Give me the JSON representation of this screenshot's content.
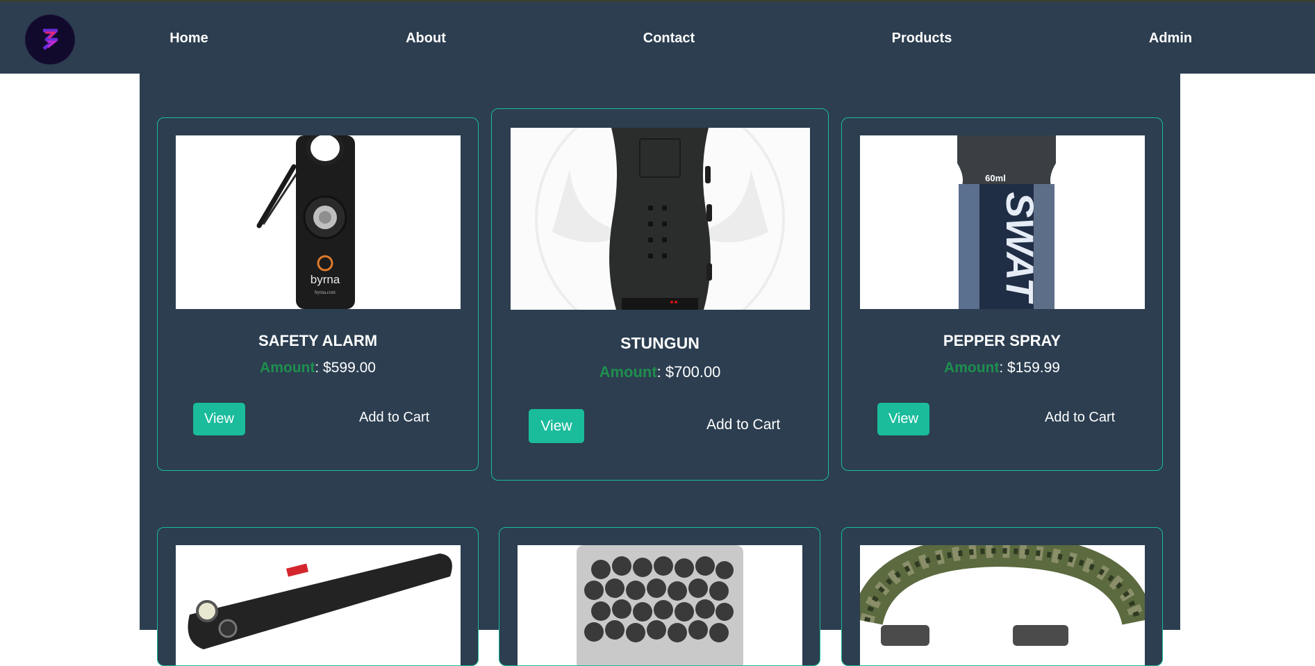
{
  "nav": {
    "logo_alt": "logo",
    "links": [
      "Home",
      "About",
      "Contact",
      "Products",
      "Admin"
    ]
  },
  "colors": {
    "navbar": "#2c3e50",
    "accent": "#1abc9c",
    "amount_label": "#1e8f4e"
  },
  "products": [
    {
      "name": "SAFETY ALARM",
      "amount_label": "Amount",
      "price": ": $599.00",
      "view_label": "View",
      "cart_label": "Add to Cart",
      "image": "black keychain safety alarm with carabiner, byrna brand"
    },
    {
      "name": "STUNGUN",
      "amount_label": "Amount",
      "price": ": $700.00",
      "view_label": "View",
      "cart_label": "Add to Cart",
      "image": "black handheld stun gun"
    },
    {
      "name": "PEPPER SPRAY",
      "amount_label": "Amount",
      "price": ": $159.99",
      "view_label": "View",
      "cart_label": "Add to Cart",
      "image": "SWAT pepper spray canister 60ml"
    },
    {
      "name": "",
      "image": "black pepper ball launcher pistol"
    },
    {
      "name": "",
      "image": "jar of black kinetic balls"
    },
    {
      "name": "",
      "image": "camouflage paracord bracelet"
    }
  ],
  "image_text": {
    "byrna": "byrna",
    "byrna_url": "byrna.com",
    "spray_volume": "60ml",
    "spray_brand": "SWAT"
  }
}
